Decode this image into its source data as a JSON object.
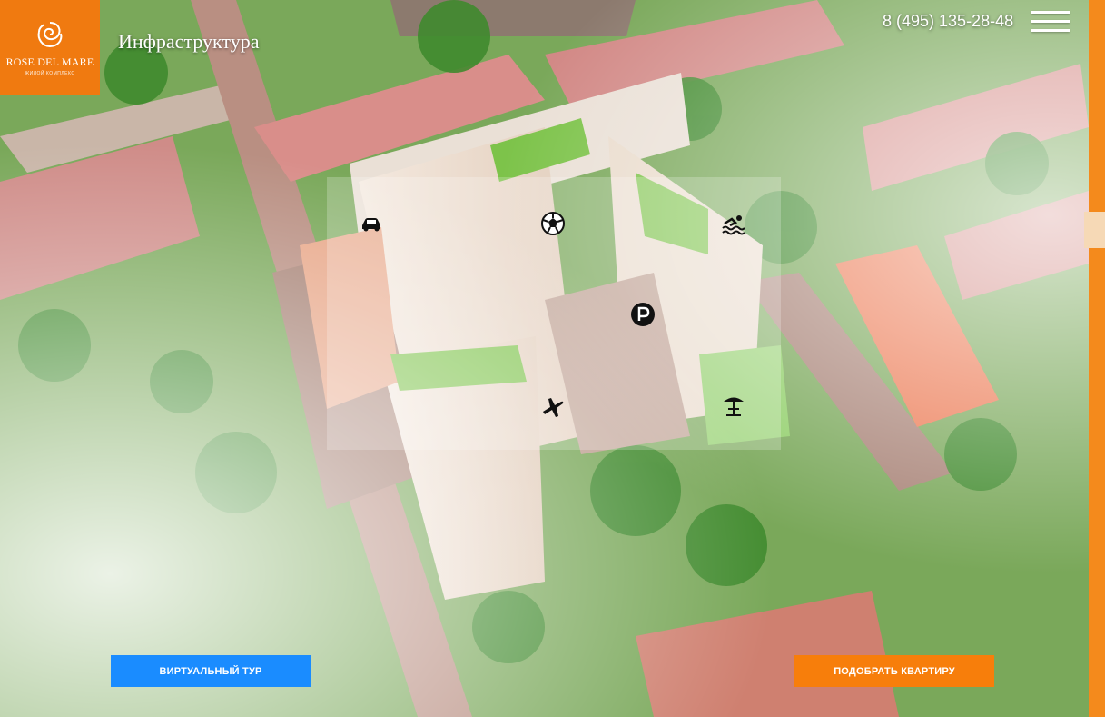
{
  "logo": {
    "name": "ROSE DEL MARE",
    "subtitle": "ЖИЛОЙ КОМПЛЕКС"
  },
  "header": {
    "title": "Инфраструктура",
    "phone": "8 (495) 135-28-48",
    "menu_icon": "hamburger-icon"
  },
  "pois": [
    {
      "icon": "car-icon"
    },
    {
      "icon": "football-icon"
    },
    {
      "icon": "swimming-icon"
    },
    {
      "icon": "parking-icon"
    },
    {
      "icon": "airplane-icon"
    },
    {
      "icon": "beach-umbrella-icon"
    }
  ],
  "buttons": {
    "virtual_tour": "ВИРТУАЛЬНЫЙ ТУР",
    "pick_apartment": "ПОДОБРАТЬ КВАРТИРУ"
  },
  "colors": {
    "brand_orange": "#f07a10",
    "tour_blue": "#1a8cff",
    "apartment_orange": "#f77e0b"
  }
}
